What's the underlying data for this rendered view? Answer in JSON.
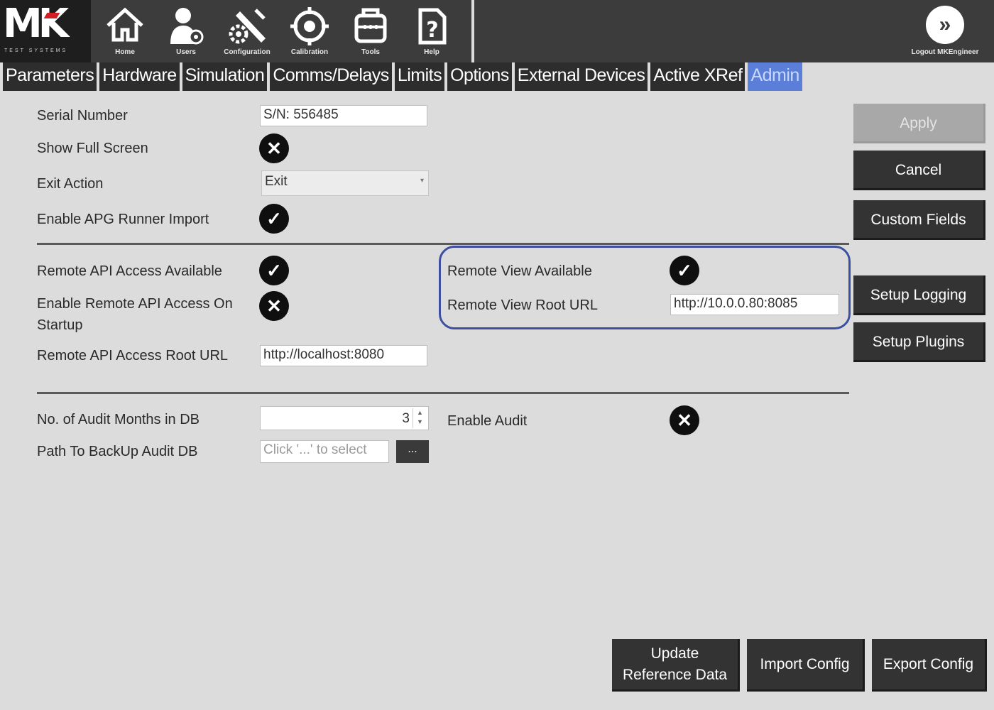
{
  "logo": {
    "text_m": "M",
    "text_k": "K",
    "subtitle": "TEST SYSTEMS"
  },
  "toolbar": {
    "items": [
      {
        "label": "Home",
        "icon": "home-icon"
      },
      {
        "label": "Users",
        "icon": "users-icon"
      },
      {
        "label": "Configuration",
        "icon": "configuration-icon"
      },
      {
        "label": "Calibration",
        "icon": "calibration-icon"
      },
      {
        "label": "Tools",
        "icon": "tools-icon"
      },
      {
        "label": "Help",
        "icon": "help-icon"
      }
    ],
    "logout_label": "Logout MKEngineer",
    "logout_glyph": "»"
  },
  "tabs": [
    "Parameters",
    "Hardware",
    "Simulation",
    "Comms/Delays",
    "Limits",
    "Options",
    "External Devices",
    "Active XRef",
    "Admin"
  ],
  "active_tab": "Admin",
  "form": {
    "serial_number_label": "Serial Number",
    "serial_number_value": "S/N: 556485",
    "show_full_screen_label": "Show Full Screen",
    "exit_action_label": "Exit Action",
    "exit_action_value": "Exit",
    "enable_apg_label": "Enable APG Runner Import",
    "remote_api_available_label": "Remote API Access Available",
    "enable_remote_api_startup_label_1": "Enable Remote API Access On",
    "enable_remote_api_startup_label_2": "Startup",
    "remote_api_root_url_label": "Remote API Access Root URL",
    "remote_api_root_url_value": "http://localhost:8080",
    "remote_view_available_label": "Remote View Available",
    "remote_view_root_url_label": "Remote View Root URL",
    "remote_view_root_url_value": "http://10.0.0.80:8085",
    "audit_months_label": "No. of Audit Months in DB",
    "audit_months_value": "3",
    "path_backup_label": "Path To BackUp Audit DB",
    "path_backup_placeholder": "Click '...' to select",
    "browse_label": "...",
    "enable_audit_label": "Enable Audit"
  },
  "toggles": {
    "show_full_screen": "✕",
    "enable_apg": "✓",
    "remote_api_available": "✓",
    "enable_remote_api_startup": "✕",
    "remote_view_available": "✓",
    "enable_audit": "✕"
  },
  "buttons": {
    "apply": "Apply",
    "cancel": "Cancel",
    "custom_fields": "Custom Fields",
    "setup_logging": "Setup Logging",
    "setup_plugins": "Setup Plugins",
    "update_reference_data_1": "Update",
    "update_reference_data_2": "Reference Data",
    "import_config": "Import Config",
    "export_config": "Export Config"
  },
  "colors": {
    "toolbar_bg": "#3c3c3c",
    "tab_bg": "#2d2d2d",
    "active_tab_bg": "#5b7fd8",
    "highlight_border": "#3d4fa0",
    "content_bg": "#dcdcdc"
  }
}
